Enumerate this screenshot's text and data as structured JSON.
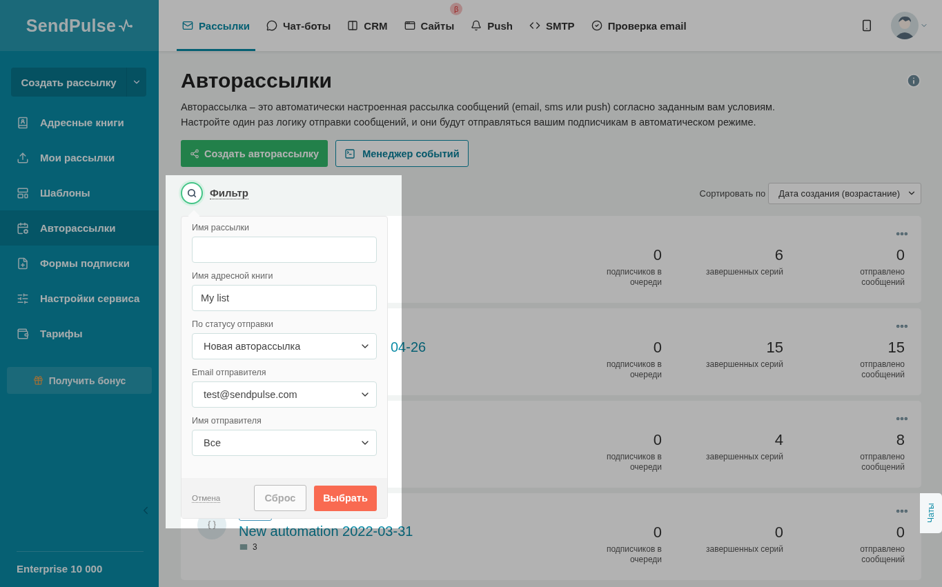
{
  "logo": {
    "text": "SendPulse"
  },
  "top_nav": {
    "tabs": [
      {
        "label": "Рассылки",
        "selected": true
      },
      {
        "label": "Чат-боты",
        "selected": false
      },
      {
        "label": "CRM",
        "selected": false
      },
      {
        "label": "Сайты",
        "selected": false,
        "badge": "β"
      },
      {
        "label": "Push",
        "selected": false
      },
      {
        "label": "SMTP",
        "selected": false
      },
      {
        "label": "Проверка email",
        "selected": false
      }
    ]
  },
  "sidebar": {
    "create_button": "Создать рассылку",
    "items": [
      {
        "label": "Адресные книги",
        "selected": false
      },
      {
        "label": "Мои рассылки",
        "selected": false
      },
      {
        "label": "Шаблоны",
        "selected": false
      },
      {
        "label": "Авторассылки",
        "selected": true
      },
      {
        "label": "Формы подписки",
        "selected": false
      },
      {
        "label": "Настройки сервиса",
        "selected": false
      },
      {
        "label": "Тарифы",
        "selected": false
      }
    ],
    "bonus_button": "Получить бонус",
    "plan": "Enterprise 10 000"
  },
  "page": {
    "title": "Авторассылки",
    "description": [
      "Авторассылка – это автоматически настроенная рассылка сообщений (email, sms или push) согласно заданным вам условиям.",
      "Настройте один раз логику отправки сообщений, и они будут отправляться вашим подписчикам в автоматическом режиме."
    ],
    "buttons": [
      {
        "label": "Создать авторассылку"
      },
      {
        "label": "Менеджер событий"
      }
    ]
  },
  "filter": {
    "label": "Фильтр",
    "fields": [
      {
        "kind": "input",
        "label": "Имя рассылки"
      },
      {
        "kind": "input",
        "label": "Имя адресной книги",
        "value": "My list"
      },
      {
        "kind": "select",
        "label": "По статусу отправки",
        "value": "Новая авторассылка"
      },
      {
        "kind": "select",
        "label": "Email отправителя",
        "value": "test@sendpulse.com"
      },
      {
        "kind": "select",
        "label": "Имя отправителя",
        "value": "Все"
      }
    ],
    "cancel": "Отмена",
    "reset": "Сброс",
    "apply": "Выбрать"
  },
  "sort": {
    "label": "Сортировать по",
    "value": "Дата создания (возрастание)"
  },
  "cards": [
    {
      "kind": "hidden",
      "stats": [
        {
          "value": "0",
          "label": "подписчиков в очереди"
        },
        {
          "value": "6",
          "label": "завершенных серий"
        },
        {
          "value": "0",
          "label": "отправлено сообщений"
        }
      ]
    },
    {
      "kind": "partial",
      "title": "04-26",
      "stats": [
        {
          "value": "0",
          "label": "подписчиков в очереди"
        },
        {
          "value": "15",
          "label": "завершенных серий"
        },
        {
          "value": "15",
          "label": "отправлено сообщений"
        }
      ]
    },
    {
      "kind": "hidden",
      "stats": [
        {
          "value": "0",
          "label": "подписчиков в очереди"
        },
        {
          "value": "4",
          "label": "завершенных серий"
        },
        {
          "value": "8",
          "label": "отправлено сообщений"
        }
      ]
    },
    {
      "kind": "full",
      "title": "New automation 2022-03-31",
      "messages": "3",
      "stats": [
        {
          "value": "0",
          "label": "подписчиков в очереди"
        },
        {
          "value": "0",
          "label": "завершенных серий"
        },
        {
          "value": "0",
          "label": "отправлено сообщений"
        }
      ]
    }
  ],
  "chats_tab": "Чаты"
}
